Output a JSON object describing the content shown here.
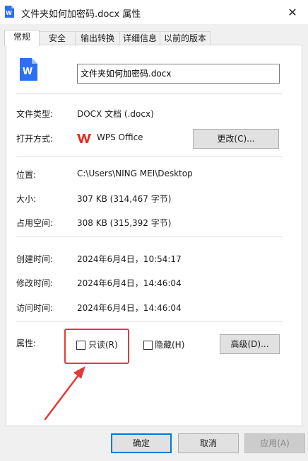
{
  "window": {
    "title": "文件夹如何加密码.docx 属性",
    "close_glyph": "✕"
  },
  "tabs": [
    {
      "label": "常规",
      "active": true
    },
    {
      "label": "安全"
    },
    {
      "label": "输出转换"
    },
    {
      "label": "详细信息"
    },
    {
      "label": "以前的版本"
    }
  ],
  "general": {
    "file_name": "文件夹如何加密码.docx",
    "file_type_label": "文件类型:",
    "file_type_value": "DOCX 文档 (.docx)",
    "open_with_label": "打开方式:",
    "open_with_app": "WPS Office",
    "change_button": "更改(C)...",
    "location_label": "位置:",
    "location_value": "C:\\Users\\NING MEI\\Desktop",
    "size_label": "大小:",
    "size_value": "307 KB (314,467 字节)",
    "size_on_disk_label": "占用空间:",
    "size_on_disk_value": "308 KB (315,392 字节)",
    "created_label": "创建时间:",
    "created_value": "2024年6月4日，10:54:17",
    "modified_label": "修改时间:",
    "modified_value": "2024年6月4日，14:46:04",
    "accessed_label": "访问时间:",
    "accessed_value": "2024年6月4日，14:46:04",
    "attributes_label": "属性:",
    "readonly_label": "只读(R)",
    "readonly_checked": false,
    "hidden_label": "隐藏(H)",
    "hidden_checked": false,
    "advanced_button": "高级(D)..."
  },
  "footer": {
    "ok": "确定",
    "cancel": "取消",
    "apply": "应用(A)"
  },
  "icons": {
    "file": "wps-writer-file-icon",
    "app": "wps-office-logo-icon",
    "annotation": "red-arrow-icon"
  },
  "colors": {
    "annotation": "#e53935",
    "focus_border": "#0078d7",
    "wps_blue": "#2b6ff3",
    "wps_red": "#e02e24"
  }
}
